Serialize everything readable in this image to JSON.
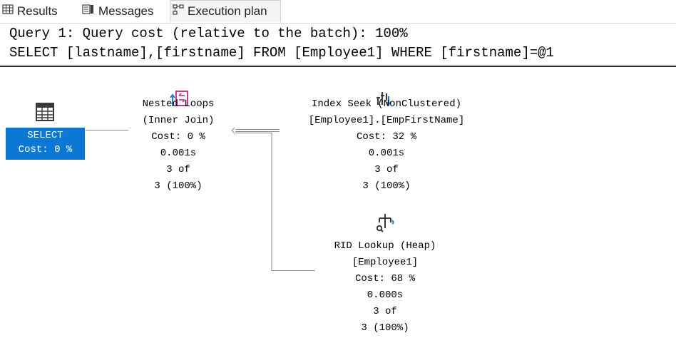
{
  "tabs": [
    {
      "label": "Results",
      "icon": "grid-icon",
      "active": false
    },
    {
      "label": "Messages",
      "icon": "messages-icon",
      "active": false
    },
    {
      "label": "Execution plan",
      "icon": "execution-plan-icon",
      "active": true
    }
  ],
  "query": {
    "line1": "Query 1: Query cost (relative to the batch): 100%",
    "line2": "SELECT [lastname],[firstname] FROM [Employee1] WHERE [firstname]=@1"
  },
  "nodes": {
    "select": {
      "label": "SELECT",
      "cost": "Cost: 0 %",
      "icon": "select-table-icon"
    },
    "nested_loops": {
      "line1": "Nested Loops",
      "line2": "(Inner Join)",
      "cost": "Cost: 0 %",
      "time": "0.001s",
      "rows_of": "3 of",
      "rows": "3 (100%)",
      "icon": "nested-loops-icon"
    },
    "index_seek": {
      "line1": "Index Seek (NonClustered)",
      "line2": "[Employee1].[EmpFirstName]",
      "cost": "Cost: 32 %",
      "time": "0.001s",
      "rows_of": "3 of",
      "rows": "3 (100%)",
      "icon": "index-seek-icon"
    },
    "rid_lookup": {
      "line1": "RID Lookup (Heap)",
      "line2": "[Employee1]",
      "cost": "Cost: 68 %",
      "time": "0.000s",
      "rows_of": "3 of",
      "rows": "3 (100%)",
      "icon": "rid-lookup-icon"
    }
  },
  "colors": {
    "selected_node": "#0d78d4",
    "connector": "#8c8c8c",
    "icon_blue": "#1f7fd6",
    "icon_pink": "#c2379a"
  }
}
